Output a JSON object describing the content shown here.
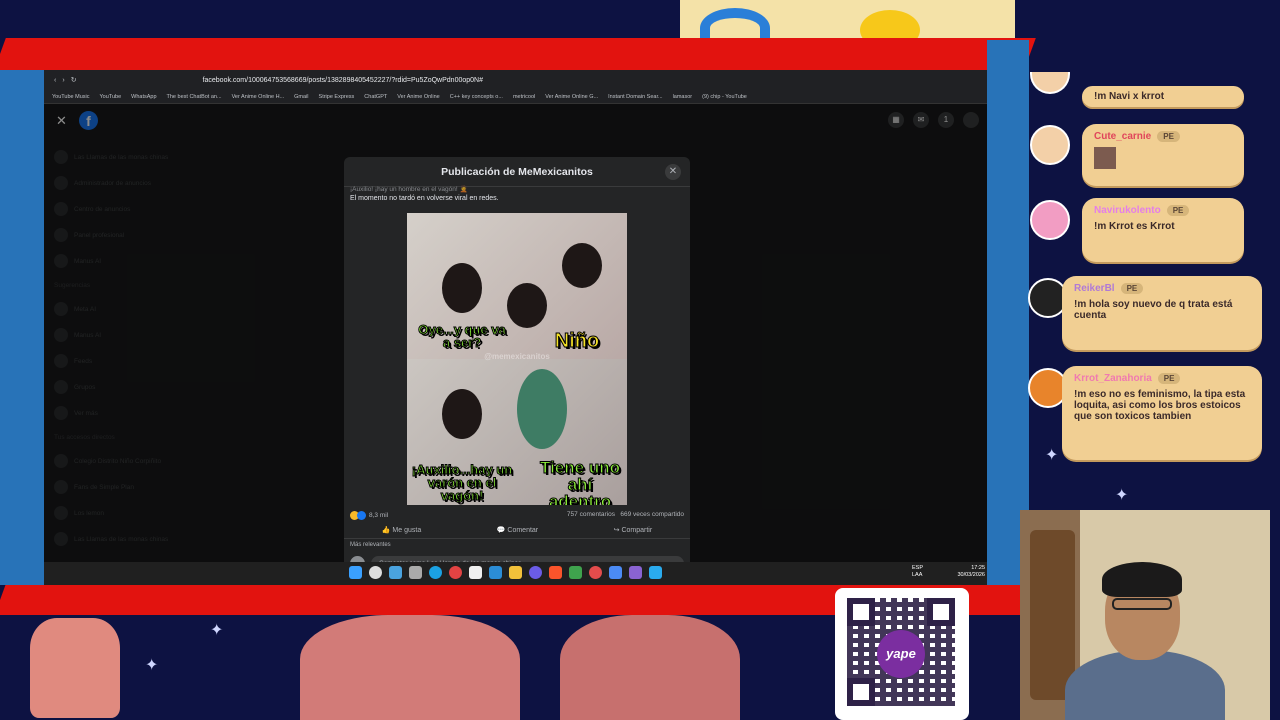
{
  "browser": {
    "url": "facebook.com/100064753568669/posts/1382898405452227/?rdid=Pu5ZoQwPdn00op0N#",
    "bookmarks": [
      "YouTube Music",
      "YouTube",
      "WhatsApp",
      "The best ChatBot an...",
      "Ver Anime Online H...",
      "Gmail",
      "Stripe Express",
      "ChatGPT",
      "Ver Anime Online",
      "C++ key concepts o...",
      "metricool",
      "Ver Anime Online G...",
      "Instant Domain Sear...",
      "lamasor",
      "(9) chip - YouTube"
    ]
  },
  "sidebar": {
    "items": [
      "Las Llamas de las monas chinas",
      "Administrador de anuncios",
      "Centro de anuncios",
      "Panel profesional",
      "Manus AI"
    ],
    "suggestions_header": "Sugerencias",
    "suggestions": [
      "Meta AI",
      "Manus AI",
      "Feeds",
      "Grupos",
      "Ver más"
    ],
    "shortcuts_header": "Tus accesos directos",
    "shortcuts": [
      "Colegio Distrito Niño Corpiñito",
      "Fans de Simple Plan",
      "Los lemon",
      "Las Llamas de las monas chinas"
    ]
  },
  "modal": {
    "title": "Publicación de MeMexicanitos",
    "cut_text": "¡Auxilio! ¡hay un hombre en el vagón! 🤦",
    "description": "El momento no tardó en volverse viral en redes.",
    "meme": {
      "text1": "Oye...y que va a ser?",
      "text2": "Niño",
      "text3": "¡Auxilio...hay un varón en el vagón!",
      "text4": "Tiene uno ahí adentro",
      "watermark": "@memexicanitos"
    },
    "reaction_count": "8,3 mil",
    "comments": "757 comentarios",
    "shares": "669 veces compartido",
    "like_label": "Me gusta",
    "comment_label": "Comentar",
    "share_label": "Compartir",
    "sort_label": "Más relevantes",
    "comment_placeholder": "Comentar como Las Llamas de las monas chinas"
  },
  "taskbar": {
    "lang": "ESP",
    "lang2": "LAA",
    "time": "17:25",
    "date": "30/03/2026"
  },
  "notification_count": "1",
  "chat": [
    {
      "name": "",
      "badge": "",
      "message": "!m Navi x krrot"
    },
    {
      "name": "Cute_carnie",
      "badge": "PE",
      "message": ""
    },
    {
      "name": "Navirukolento",
      "badge": "PE",
      "message": "!m Krrot es Krrot"
    },
    {
      "name": "ReikerBl",
      "badge": "PE",
      "message": "!m hola soy nuevo de q trata está cuenta"
    },
    {
      "name": "Krrot_Zanahoria",
      "badge": "PE",
      "message": "!m eso no es feminismo, la tipa esta loquita, asi como los bros estoicos que son toxicos tambien"
    }
  ],
  "qr": {
    "brand": "yape"
  },
  "colors": {
    "accent": "#e2130f",
    "fb_blue": "#1877f2",
    "chat_bubble": "#f1cf93"
  }
}
